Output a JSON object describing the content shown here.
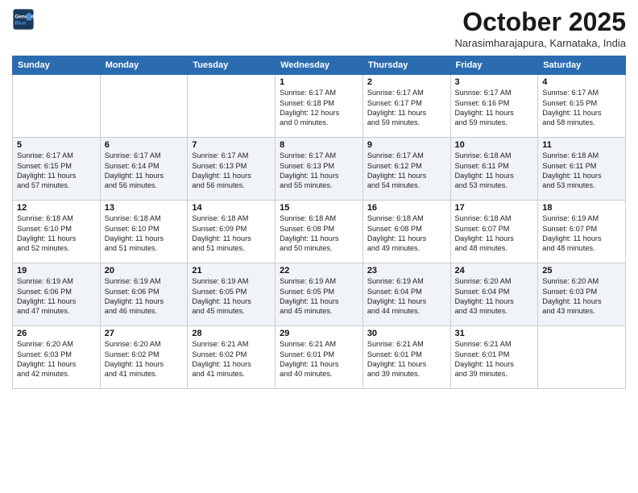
{
  "logo": {
    "line1": "General",
    "line2": "Blue"
  },
  "header": {
    "month": "October 2025",
    "location": "Narasimharajapura, Karnataka, India"
  },
  "weekdays": [
    "Sunday",
    "Monday",
    "Tuesday",
    "Wednesday",
    "Thursday",
    "Friday",
    "Saturday"
  ],
  "weeks": [
    [
      {
        "day": "",
        "text": ""
      },
      {
        "day": "",
        "text": ""
      },
      {
        "day": "",
        "text": ""
      },
      {
        "day": "1",
        "text": "Sunrise: 6:17 AM\nSunset: 6:18 PM\nDaylight: 12 hours\nand 0 minutes."
      },
      {
        "day": "2",
        "text": "Sunrise: 6:17 AM\nSunset: 6:17 PM\nDaylight: 11 hours\nand 59 minutes."
      },
      {
        "day": "3",
        "text": "Sunrise: 6:17 AM\nSunset: 6:16 PM\nDaylight: 11 hours\nand 59 minutes."
      },
      {
        "day": "4",
        "text": "Sunrise: 6:17 AM\nSunset: 6:15 PM\nDaylight: 11 hours\nand 58 minutes."
      }
    ],
    [
      {
        "day": "5",
        "text": "Sunrise: 6:17 AM\nSunset: 6:15 PM\nDaylight: 11 hours\nand 57 minutes."
      },
      {
        "day": "6",
        "text": "Sunrise: 6:17 AM\nSunset: 6:14 PM\nDaylight: 11 hours\nand 56 minutes."
      },
      {
        "day": "7",
        "text": "Sunrise: 6:17 AM\nSunset: 6:13 PM\nDaylight: 11 hours\nand 56 minutes."
      },
      {
        "day": "8",
        "text": "Sunrise: 6:17 AM\nSunset: 6:13 PM\nDaylight: 11 hours\nand 55 minutes."
      },
      {
        "day": "9",
        "text": "Sunrise: 6:17 AM\nSunset: 6:12 PM\nDaylight: 11 hours\nand 54 minutes."
      },
      {
        "day": "10",
        "text": "Sunrise: 6:18 AM\nSunset: 6:11 PM\nDaylight: 11 hours\nand 53 minutes."
      },
      {
        "day": "11",
        "text": "Sunrise: 6:18 AM\nSunset: 6:11 PM\nDaylight: 11 hours\nand 53 minutes."
      }
    ],
    [
      {
        "day": "12",
        "text": "Sunrise: 6:18 AM\nSunset: 6:10 PM\nDaylight: 11 hours\nand 52 minutes."
      },
      {
        "day": "13",
        "text": "Sunrise: 6:18 AM\nSunset: 6:10 PM\nDaylight: 11 hours\nand 51 minutes."
      },
      {
        "day": "14",
        "text": "Sunrise: 6:18 AM\nSunset: 6:09 PM\nDaylight: 11 hours\nand 51 minutes."
      },
      {
        "day": "15",
        "text": "Sunrise: 6:18 AM\nSunset: 6:08 PM\nDaylight: 11 hours\nand 50 minutes."
      },
      {
        "day": "16",
        "text": "Sunrise: 6:18 AM\nSunset: 6:08 PM\nDaylight: 11 hours\nand 49 minutes."
      },
      {
        "day": "17",
        "text": "Sunrise: 6:18 AM\nSunset: 6:07 PM\nDaylight: 11 hours\nand 48 minutes."
      },
      {
        "day": "18",
        "text": "Sunrise: 6:19 AM\nSunset: 6:07 PM\nDaylight: 11 hours\nand 48 minutes."
      }
    ],
    [
      {
        "day": "19",
        "text": "Sunrise: 6:19 AM\nSunset: 6:06 PM\nDaylight: 11 hours\nand 47 minutes."
      },
      {
        "day": "20",
        "text": "Sunrise: 6:19 AM\nSunset: 6:06 PM\nDaylight: 11 hours\nand 46 minutes."
      },
      {
        "day": "21",
        "text": "Sunrise: 6:19 AM\nSunset: 6:05 PM\nDaylight: 11 hours\nand 45 minutes."
      },
      {
        "day": "22",
        "text": "Sunrise: 6:19 AM\nSunset: 6:05 PM\nDaylight: 11 hours\nand 45 minutes."
      },
      {
        "day": "23",
        "text": "Sunrise: 6:19 AM\nSunset: 6:04 PM\nDaylight: 11 hours\nand 44 minutes."
      },
      {
        "day": "24",
        "text": "Sunrise: 6:20 AM\nSunset: 6:04 PM\nDaylight: 11 hours\nand 43 minutes."
      },
      {
        "day": "25",
        "text": "Sunrise: 6:20 AM\nSunset: 6:03 PM\nDaylight: 11 hours\nand 43 minutes."
      }
    ],
    [
      {
        "day": "26",
        "text": "Sunrise: 6:20 AM\nSunset: 6:03 PM\nDaylight: 11 hours\nand 42 minutes."
      },
      {
        "day": "27",
        "text": "Sunrise: 6:20 AM\nSunset: 6:02 PM\nDaylight: 11 hours\nand 41 minutes."
      },
      {
        "day": "28",
        "text": "Sunrise: 6:21 AM\nSunset: 6:02 PM\nDaylight: 11 hours\nand 41 minutes."
      },
      {
        "day": "29",
        "text": "Sunrise: 6:21 AM\nSunset: 6:01 PM\nDaylight: 11 hours\nand 40 minutes."
      },
      {
        "day": "30",
        "text": "Sunrise: 6:21 AM\nSunset: 6:01 PM\nDaylight: 11 hours\nand 39 minutes."
      },
      {
        "day": "31",
        "text": "Sunrise: 6:21 AM\nSunset: 6:01 PM\nDaylight: 11 hours\nand 39 minutes."
      },
      {
        "day": "",
        "text": ""
      }
    ]
  ]
}
